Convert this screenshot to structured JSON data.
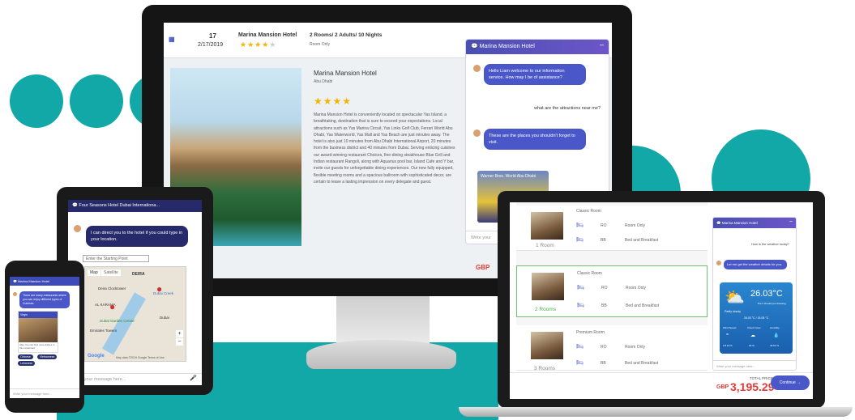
{
  "monitor": {
    "header": {
      "day": "17",
      "date": "2/17/2019",
      "hotel_name": "Marina Mansion Hotel",
      "rooms": "2 Rooms/ 2 Adults/ 10 Nights",
      "board": "Room Only"
    },
    "hotel": {
      "name": "Marina Mansion Hotel",
      "location": "Abu Dhabi",
      "stars": "★★★★",
      "description": "Marina Mansion Hotel is conveniently located on spectacular Yas Island, a breathtaking, destination that is sure to exceed your expectations. Local attractions such as Yas Marina Circuit, Yas Links Golf Club, Ferrari World Abu Dhabi, Yas Waterworld, Yas Mall and Yas Beach are just minutes away. The hotel is also just 10 minutes from Abu Dhabi International Airport, 20 minutes from the business district and 40 minutes from Dubai. Serving enticing cuisines our award-winning restaurant Choices, fine-dining steakhouse Blue Grill and Indian restaurant Rangoli, along with Aquarius pool bar, Island Cafe and Y bar, invite our guests for unforgettable dining experiences. Our new fully equipped, flexible meeting rooms and a spacious ballroom with sophisticated decor, are certain to leave a lasting impression on every delegate and guest."
    },
    "chat": {
      "title": "Marina Mansion Hotel",
      "bot_1": "Hello Liam welcome to our information service. How may I be of assistance?",
      "user_1": "what are the attractions near me?",
      "bot_2": "These are the places you shouldn't forget to visit.",
      "card_title": "Warner Bros. World Abu Dhabi",
      "input_placeholder": "Write your"
    },
    "currency_peek": "GBP"
  },
  "tablet": {
    "chat_title": "Four Seasons Hotel Dubai Internationa...",
    "bot_msg": "I can direct you to the hotel if you could type in your location.",
    "start_placeholder": "Enter the Starting Point",
    "map_tab": "Map",
    "satellite_tab": "Satellite",
    "map_labels": [
      "DEIRA",
      "Deira Clocktower",
      "Dubai Creek",
      "AL KARAMA",
      "Dubai Garden Centre",
      "Emirates Towers",
      "Dubai"
    ],
    "map_footer": "Map data ©2019 Google  Terms of Use",
    "google_logo": "Google",
    "input_placeholder": "Enter your message here..."
  },
  "phone": {
    "chat_title": "Marina Mansion Hotel",
    "bot_msg": "There are many restaurants where you can enjoy different types of Cuisines.",
    "card_title": "Virgin",
    "card_sub": "Also You can find more dishes in this restaurant",
    "tags": [
      "Chinese",
      "Vietnamese",
      "Lebanese"
    ],
    "input_placeholder": "Write your message here..."
  },
  "laptop": {
    "rooms": [
      {
        "name": "Classic Room",
        "count": "1 Room",
        "options": [
          {
            "code": "RO",
            "label": "Room Only"
          },
          {
            "code": "BB",
            "label": "Bed and Breakfast"
          }
        ]
      },
      {
        "name": "Classic Room",
        "count": "2 Rooms",
        "options": [
          {
            "code": "RO",
            "label": "Room Only"
          },
          {
            "code": "BB",
            "label": "Bed and Breakfast"
          }
        ]
      },
      {
        "name": "Premium Room",
        "count": "3 Rooms",
        "options": [
          {
            "code": "RO",
            "label": "Room Only"
          },
          {
            "code": "BB",
            "label": "Bed and Breakfast"
          }
        ]
      }
    ],
    "chat": {
      "title": "Marina Mansion Hotel",
      "user_msg": "How is the weather today?",
      "bot_msg": "Let me get the weather details for you.",
      "temperature": "26.03°C",
      "feels_like": "The It should you dressing",
      "condition": "Partly cloudy",
      "range": "26.03 °C / 15.05 °C",
      "stats": [
        {
          "label": "Wind Speed",
          "value": "2.8 km/h"
        },
        {
          "label": "Cloud Cover",
          "value": "20 %"
        },
        {
          "label": "Humidity",
          "value": "40.52 %"
        }
      ],
      "input_placeholder": "Write your message here..."
    },
    "total_label": "TOTAL PRICE",
    "currency": "GBP",
    "total": "3,195.29",
    "continue_label": "Continue"
  },
  "colors": {
    "teal": "#12a8a8",
    "accent": "#4a57c8"
  }
}
